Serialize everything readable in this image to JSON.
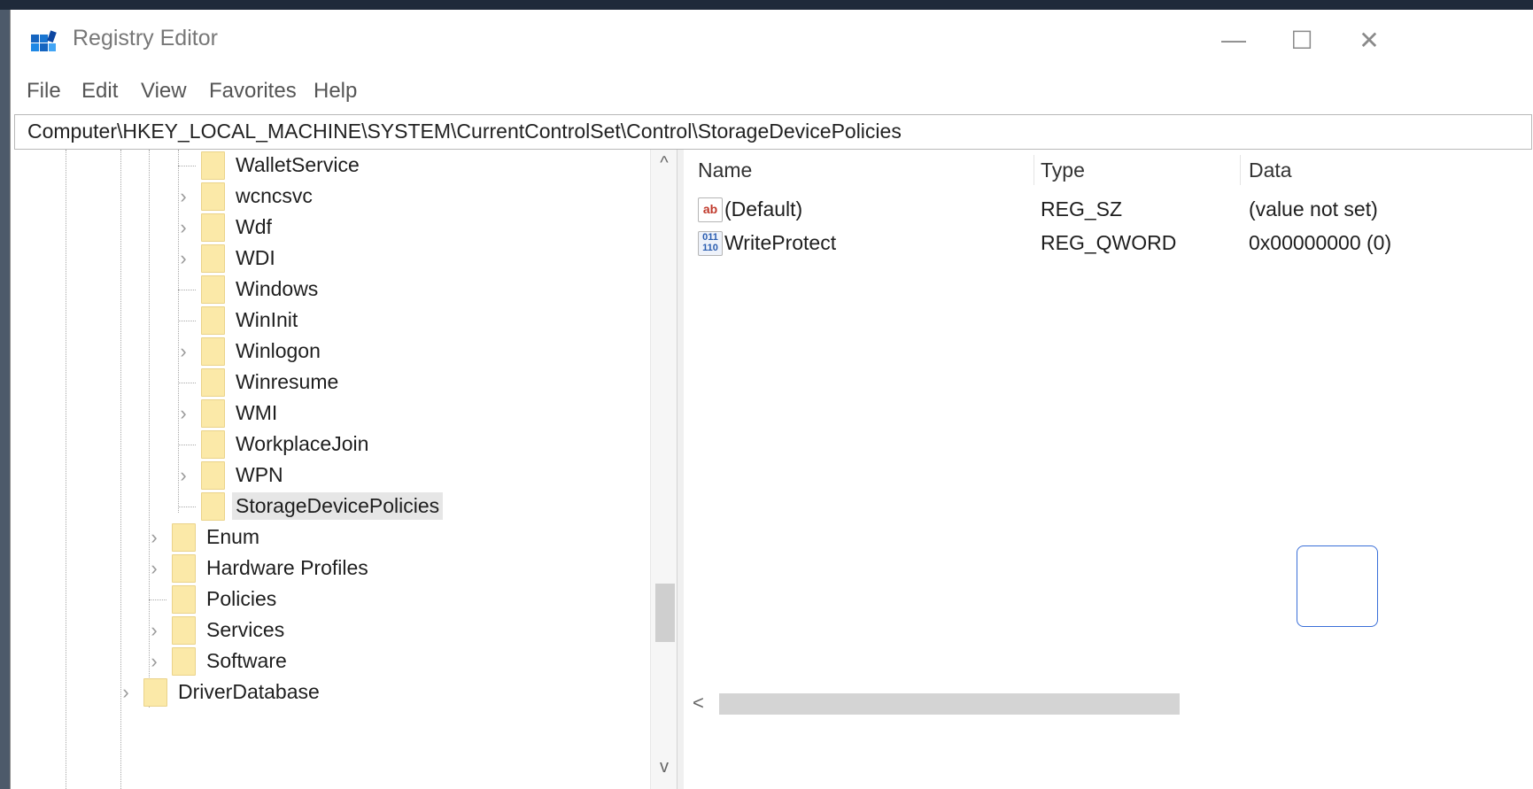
{
  "window": {
    "title": "Registry Editor",
    "controls": {
      "minimize": "—",
      "maximize": "☐",
      "close": "✕"
    }
  },
  "menu": [
    "File",
    "Edit",
    "View",
    "Favorites",
    "Help"
  ],
  "address": "Computer\\HKEY_LOCAL_MACHINE\\SYSTEM\\CurrentControlSet\\Control\\StorageDevicePolicies",
  "tree": [
    {
      "label": "WalletService",
      "expandable": false
    },
    {
      "label": "wcncsvc",
      "expandable": true
    },
    {
      "label": "Wdf",
      "expandable": true
    },
    {
      "label": "WDI",
      "expandable": true
    },
    {
      "label": "Windows",
      "expandable": false
    },
    {
      "label": "WinInit",
      "expandable": false
    },
    {
      "label": "Winlogon",
      "expandable": true
    },
    {
      "label": "Winresume",
      "expandable": false
    },
    {
      "label": "WMI",
      "expandable": true
    },
    {
      "label": "WorkplaceJoin",
      "expandable": false
    },
    {
      "label": "WPN",
      "expandable": true
    },
    {
      "label": "StorageDevicePolicies",
      "expandable": false,
      "selected": true
    },
    {
      "label": "Enum",
      "expandable": true
    },
    {
      "label": "Hardware Profiles",
      "expandable": true
    },
    {
      "label": "Policies",
      "expandable": false
    },
    {
      "label": "Services",
      "expandable": true
    },
    {
      "label": "Software",
      "expandable": true
    },
    {
      "label": "DriverDatabase",
      "expandable": true
    }
  ],
  "values": {
    "columns": {
      "name": "Name",
      "type": "Type",
      "data": "Data"
    },
    "rows": [
      {
        "icon": "string-value-icon",
        "icon_text": "ab",
        "name": "(Default)",
        "type": "REG_SZ",
        "data": "(value not set)"
      },
      {
        "icon": "binary-value-icon",
        "icon_text": "011\n110",
        "name": "WriteProtect",
        "type": "REG_QWORD",
        "data": "0x00000000 (0)"
      }
    ]
  },
  "scroll": {
    "up": "^",
    "down": "v",
    "left": "<"
  },
  "colors": {
    "folder": "#fbe9a8",
    "selection": "#e6e6e6",
    "accent": "#3a6fd8"
  }
}
